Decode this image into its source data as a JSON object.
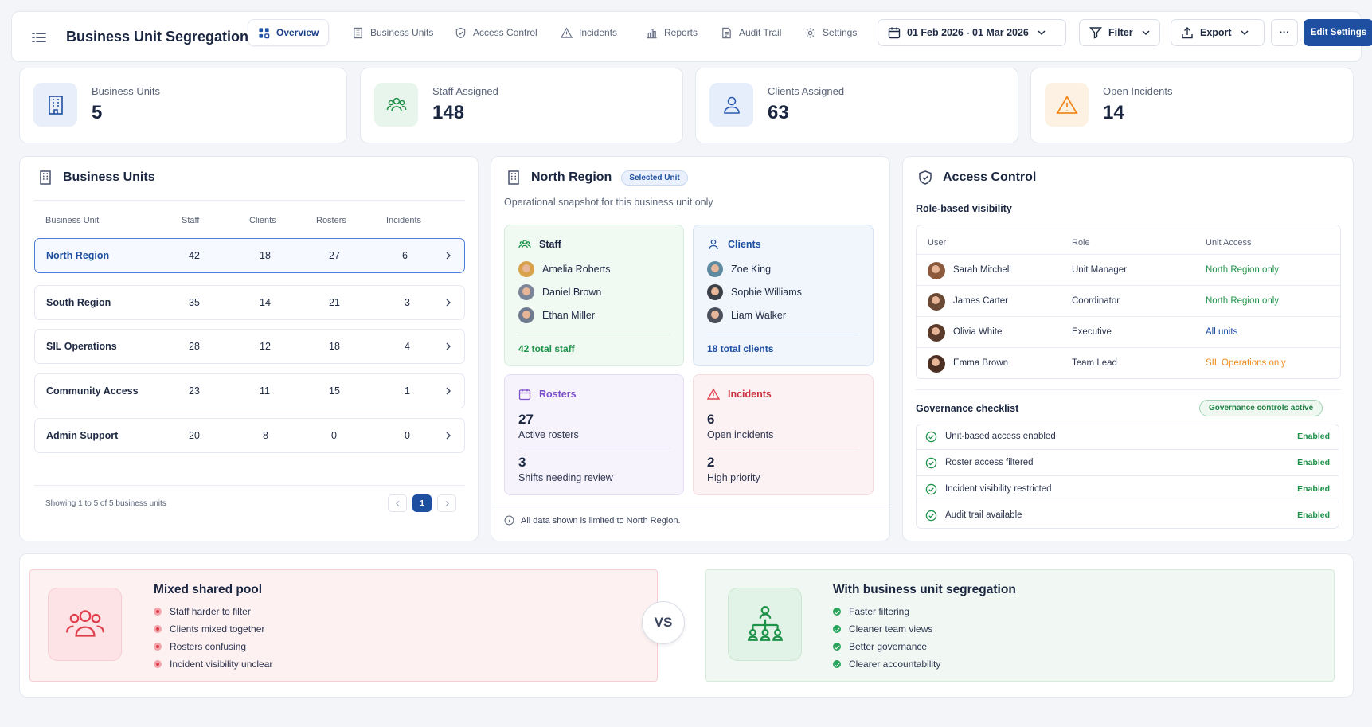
{
  "header": {
    "title": "Business Unit Segregation",
    "tabs": [
      {
        "label": "Overview",
        "icon": "grid-icon"
      },
      {
        "label": "Business Units",
        "icon": "building-icon"
      },
      {
        "label": "Access Control",
        "icon": "shield-icon"
      },
      {
        "label": "Incidents",
        "icon": "warning-icon"
      },
      {
        "label": "Reports",
        "icon": "bar-chart-icon"
      },
      {
        "label": "Audit Trail",
        "icon": "document-icon"
      },
      {
        "label": "Settings",
        "icon": "gear-icon"
      }
    ],
    "date_range": "01 Feb 2026 - 01 Mar 2026",
    "filter_label": "Filter",
    "export_label": "Export",
    "more_label": "···",
    "edit_label": "Edit Settings"
  },
  "stats": [
    {
      "label": "Business Units",
      "value": "5"
    },
    {
      "label": "Staff Assigned",
      "value": "148"
    },
    {
      "label": "Clients Assigned",
      "value": "63"
    },
    {
      "label": "Open Incidents",
      "value": "14"
    }
  ],
  "units_panel": {
    "title": "Business Units",
    "columns": [
      "Business Unit",
      "Staff",
      "Clients",
      "Rosters",
      "Incidents"
    ],
    "rows": [
      {
        "name": "North Region",
        "staff": "42",
        "clients": "18",
        "rosters": "27",
        "incidents": "6"
      },
      {
        "name": "South Region",
        "staff": "35",
        "clients": "14",
        "rosters": "21",
        "incidents": "3"
      },
      {
        "name": "SIL Operations",
        "staff": "28",
        "clients": "12",
        "rosters": "18",
        "incidents": "4"
      },
      {
        "name": "Community Access",
        "staff": "23",
        "clients": "11",
        "rosters": "15",
        "incidents": "1"
      },
      {
        "name": "Admin Support",
        "staff": "20",
        "clients": "8",
        "rosters": "0",
        "incidents": "0"
      }
    ],
    "footer": "Showing 1 to 5 of 5 business units",
    "page": "1"
  },
  "region_panel": {
    "title": "North Region",
    "badge": "Selected Unit",
    "subtitle": "Operational snapshot for this business unit only",
    "staff": {
      "title": "Staff",
      "people": [
        "Amelia Roberts",
        "Daniel Brown",
        "Ethan Miller"
      ],
      "total": "42 total staff"
    },
    "clients": {
      "title": "Clients",
      "people": [
        "Zoe King",
        "Sophie Williams",
        "Liam Walker"
      ],
      "total": "18 total clients"
    },
    "rosters": {
      "title": "Rosters",
      "n1": "27",
      "l1": "Active rosters",
      "n2": "3",
      "l2": "Shifts needing review"
    },
    "incidents": {
      "title": "Incidents",
      "n1": "6",
      "l1": "Open incidents",
      "n2": "2",
      "l2": "High priority"
    },
    "note": "All data shown is limited to North Region."
  },
  "access_panel": {
    "title": "Access Control",
    "section": "Role-based visibility",
    "columns": [
      "User",
      "Role",
      "Unit Access"
    ],
    "rows": [
      {
        "user": "Sarah Mitchell",
        "role": "Unit Manager",
        "access": "North Region only",
        "color": "#1e9249"
      },
      {
        "user": "James Carter",
        "role": "Coordinator",
        "access": "North Region only",
        "color": "#1e9249"
      },
      {
        "user": "Olivia White",
        "role": "Executive",
        "access": "All units",
        "color": "#1e4fa0"
      },
      {
        "user": "Emma Brown",
        "role": "Team Lead",
        "access": "SIL Operations only",
        "color": "#ef8a1f"
      }
    ],
    "checklist_title": "Governance checklist",
    "checklist_badge": "Governance controls active",
    "checklist": [
      {
        "label": "Unit-based access enabled",
        "status": "Enabled"
      },
      {
        "label": "Roster access filtered",
        "status": "Enabled"
      },
      {
        "label": "Incident visibility restricted",
        "status": "Enabled"
      },
      {
        "label": "Audit trail available",
        "status": "Enabled"
      }
    ]
  },
  "compare": {
    "left": {
      "title": "Mixed shared pool",
      "items": [
        "Staff harder to filter",
        "Clients mixed together",
        "Rosters confusing",
        "Incident visibility unclear"
      ]
    },
    "vs": "VS",
    "right": {
      "title": "With business unit segregation",
      "items": [
        "Faster filtering",
        "Cleaner team views",
        "Better governance",
        "Clearer accountability"
      ]
    }
  },
  "colors": {
    "brand": "#1e4fa0",
    "success": "#1e9249",
    "warning": "#ef8a1f",
    "danger": "#e0404d",
    "roster": "#7b4fc9"
  }
}
